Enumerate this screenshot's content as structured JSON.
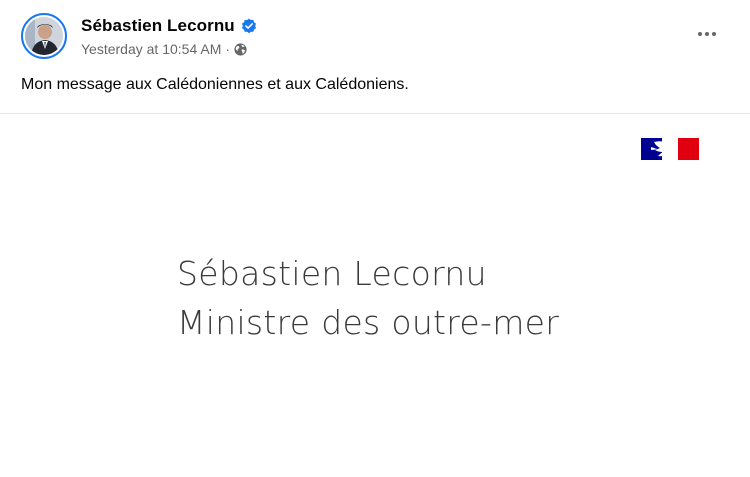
{
  "post": {
    "author": "Sébastien Lecornu",
    "timestamp": "Yesterday at 10:54 AM",
    "separator": "·",
    "audience_icon": "globe-icon",
    "verified_icon": "verified-badge-icon",
    "more_icon": "more-options-icon",
    "message": "Mon message aux Calédoniennes et aux Calédoniens."
  },
  "video": {
    "logo_icon": "marianne-flag-logo",
    "title_line1": "Sébastien Lecornu",
    "title_line2": "Ministre des outre-mer"
  },
  "colors": {
    "accent": "#1877f2",
    "secondary_text": "#65676b",
    "flag_blue": "#000091",
    "flag_red": "#e1000f"
  }
}
